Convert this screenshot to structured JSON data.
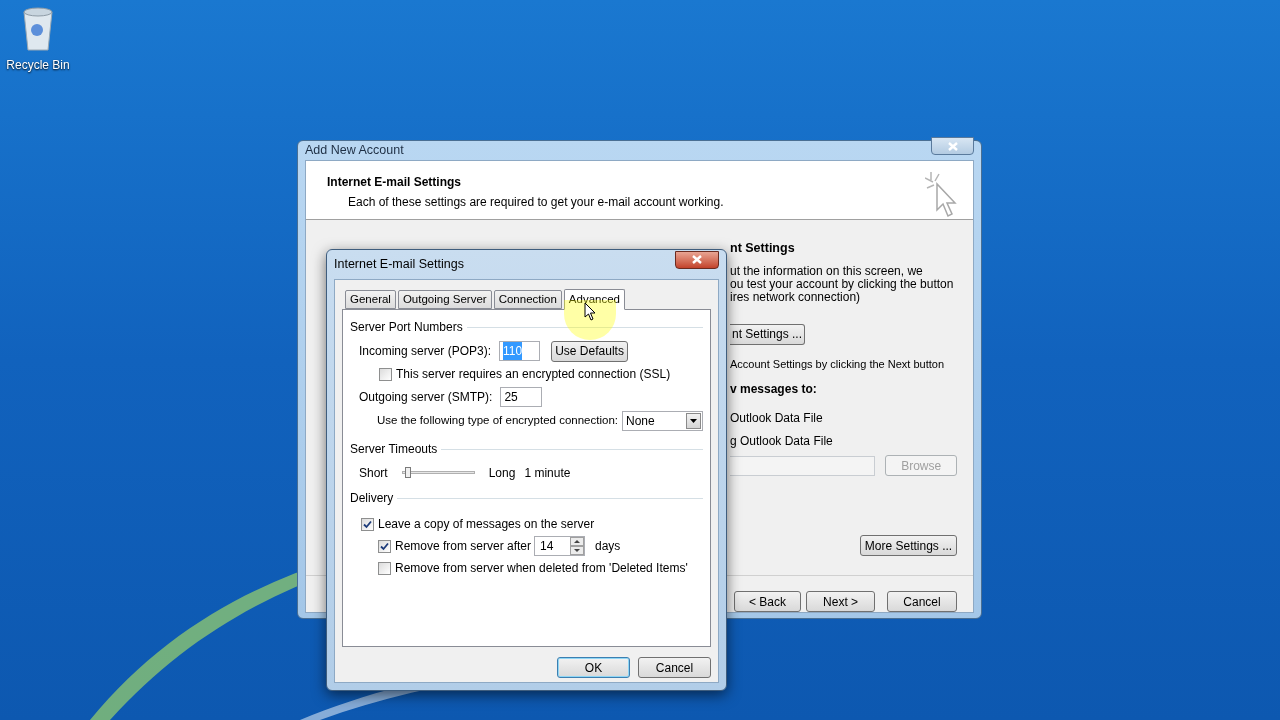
{
  "desktop": {
    "icons": [
      {
        "label": "Recycle Bin"
      }
    ]
  },
  "back_window": {
    "title": "Add New Account",
    "header": {
      "title": "Internet E-mail Settings",
      "subtitle": "Each of these settings are required to get your e-mail account working."
    },
    "right_heading": "nt Settings",
    "right_lines": [
      "ut the information on this screen, we",
      "ou test your account by clicking the button",
      "ires network connection)"
    ],
    "test_button": "nt Settings ...",
    "next_note": "Account Settings by clicking the Next button",
    "deliver_heading": "v messages to:",
    "deliver_options": [
      "Outlook Data File",
      "g Outlook Data File"
    ],
    "browse_button": {
      "label": "Browse",
      "disabled": true
    },
    "more_settings_button": "More Settings ...",
    "buttons": [
      "< Back",
      "Next >",
      "Cancel"
    ]
  },
  "dialog": {
    "title": "Internet E-mail Settings",
    "tabs": [
      {
        "label": "General",
        "selected": false
      },
      {
        "label": "Outgoing Server",
        "selected": false
      },
      {
        "label": "Connection",
        "selected": false
      },
      {
        "label": "Advanced",
        "selected": true
      }
    ],
    "port_section": {
      "title": "Server Port Numbers",
      "incoming_label": "Incoming server (POP3):",
      "incoming_value": "110",
      "incoming_value_selected": true,
      "use_defaults_button": "Use Defaults",
      "ssl": {
        "label": "This server requires an encrypted connection (SSL)",
        "checked": false
      },
      "outgoing_label": "Outgoing server (SMTP):",
      "outgoing_value": "25",
      "encryption_label": "Use the following type of encrypted connection:",
      "encryption_value": "None"
    },
    "timeout_section": {
      "title": "Server Timeouts",
      "min_label": "Short",
      "max_label": "Long",
      "level": 0.05,
      "reading": "1 minute"
    },
    "delivery_section": {
      "title": "Delivery",
      "leave_copy": {
        "label": "Leave a copy of messages on the server",
        "checked": true
      },
      "remove_after": {
        "label": "Remove from server after",
        "checked": true,
        "days": "14",
        "unit": "days"
      },
      "remove_deleted": {
        "label": "Remove from server when deleted from 'Deleted Items'",
        "checked": false
      }
    },
    "buttons": [
      {
        "label": "OK",
        "default": true
      },
      {
        "label": "Cancel",
        "default": false
      }
    ]
  }
}
